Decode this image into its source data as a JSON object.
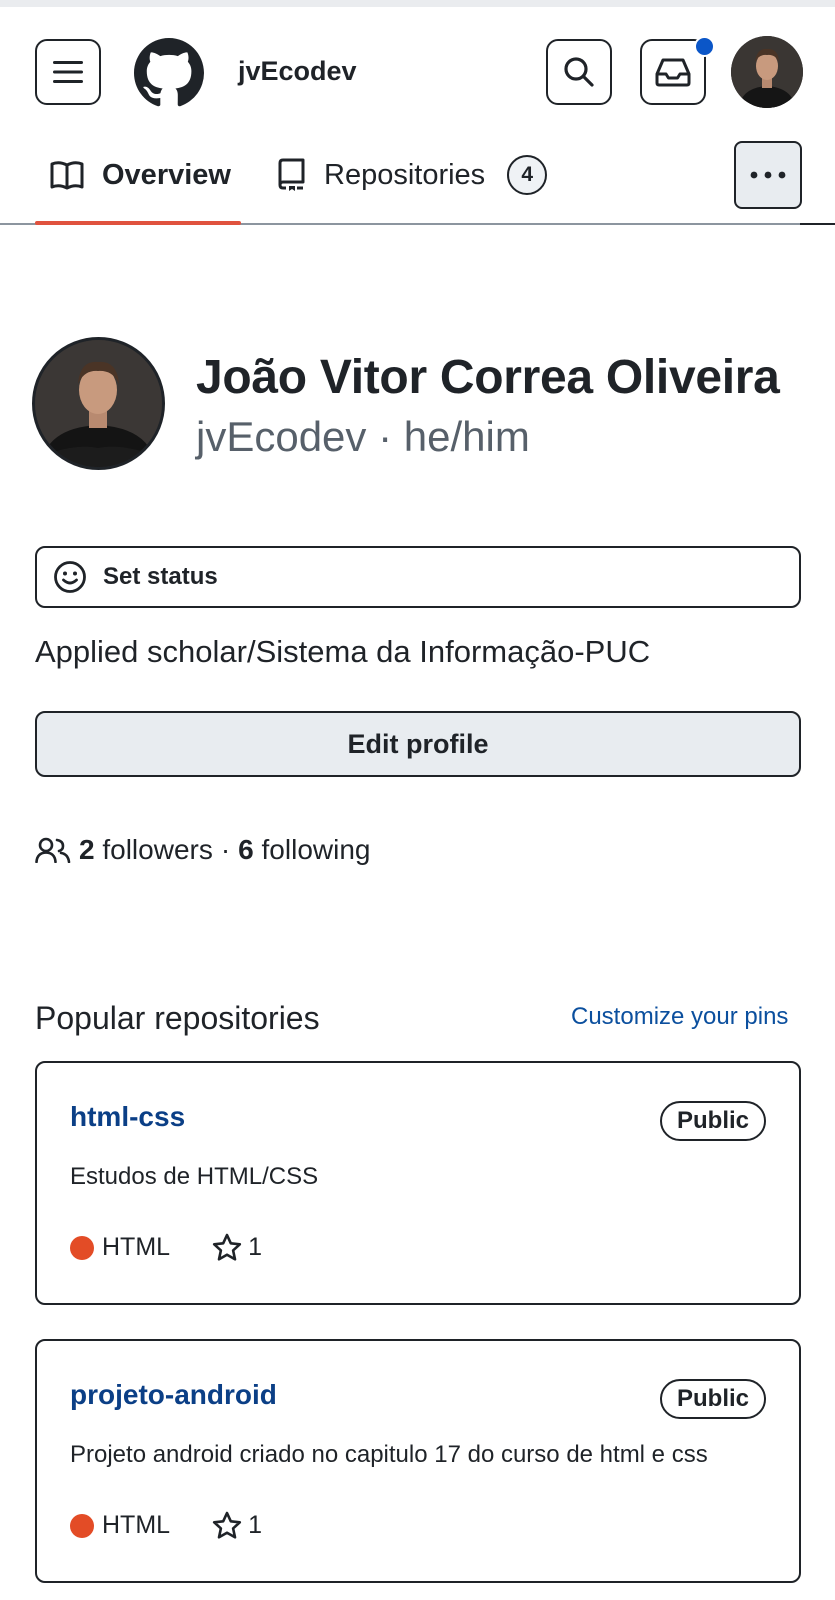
{
  "header": {
    "username": "jvEcodev",
    "menu_icon": "hamburger-icon",
    "logo_icon": "github-logo",
    "search_icon": "search-icon",
    "inbox_icon": "inbox-icon",
    "notification_color": "#0b56c8"
  },
  "tabs": [
    {
      "label": "Overview",
      "icon": "book-icon",
      "selected": true
    },
    {
      "label": "Repositories",
      "icon": "repo-icon",
      "count": "4",
      "selected": false
    }
  ],
  "colors": {
    "tab_underline": "#e0523e",
    "link": "#0b3f86",
    "html_language": "#e34c26"
  },
  "profile": {
    "name": "João Vitor Correa Oliveira",
    "handle_line": "jvEcodev · he/him",
    "status_label": "Set status",
    "bio": "Applied scholar/Sistema da Informação-PUC",
    "edit_button": "Edit profile",
    "followers_count": "2",
    "followers_label": "followers",
    "separator": "·",
    "following_count": "6",
    "following_label": "following"
  },
  "popular": {
    "title": "Popular repositories",
    "customize_link": "Customize your pins",
    "repos": [
      {
        "name": "html-css",
        "visibility": "Public",
        "description": "Estudos de HTML/CSS",
        "language": "HTML",
        "stars": "1"
      },
      {
        "name": "projeto-android",
        "visibility": "Public",
        "description": "Projeto android criado no capitulo 17 do curso de html e css",
        "language": "HTML",
        "stars": "1"
      }
    ]
  }
}
